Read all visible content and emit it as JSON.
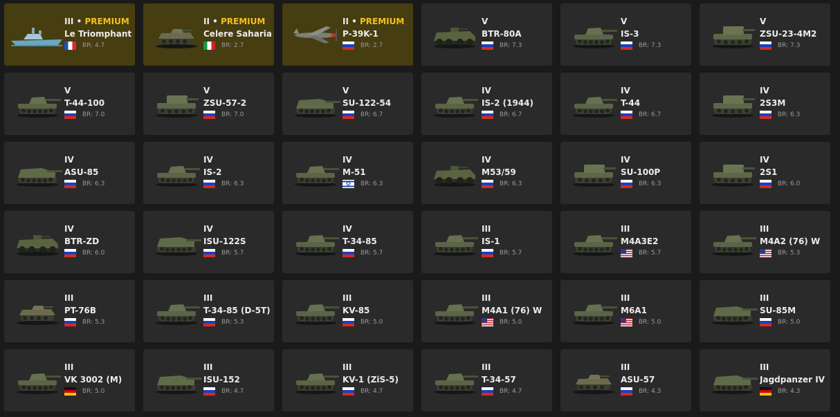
{
  "vehicles": [
    {
      "rank": "III",
      "premium": true,
      "premium_label": "PREMIUM",
      "name": "Le Triomphant",
      "flag": "france",
      "type": "ship",
      "br": "BR: 4.7"
    },
    {
      "rank": "II",
      "premium": true,
      "premium_label": "PREMIUM",
      "name": "Celere Sahariano",
      "flag": "italy",
      "type": "light",
      "br": "BR: 2.7"
    },
    {
      "rank": "II",
      "premium": true,
      "premium_label": "PREMIUM",
      "name": "P-39K-1",
      "flag": "russia",
      "type": "plane",
      "br": "BR: 2.7"
    },
    {
      "rank": "V",
      "name": "BTR-80A",
      "flag": "russia",
      "type": "apc",
      "br": "BR: 7.3"
    },
    {
      "rank": "V",
      "name": "IS-3",
      "flag": "russia",
      "type": "tank",
      "br": "BR: 7.3"
    },
    {
      "rank": "V",
      "name": "ZSU-23-4M2",
      "flag": "russia",
      "type": "spaa",
      "br": "BR: 7.3"
    },
    {
      "rank": "V",
      "name": "T-44-100",
      "flag": "russia",
      "type": "tank",
      "br": "BR: 7.0"
    },
    {
      "rank": "V",
      "name": "ZSU-57-2",
      "flag": "russia",
      "type": "spaa",
      "br": "BR: 7.0"
    },
    {
      "rank": "V",
      "name": "SU-122-54",
      "flag": "russia",
      "type": "td",
      "br": "BR: 6.7"
    },
    {
      "rank": "IV",
      "name": "IS-2 (1944)",
      "flag": "russia",
      "type": "tank",
      "br": "BR: 6.7"
    },
    {
      "rank": "IV",
      "name": "T-44",
      "flag": "russia",
      "type": "tank",
      "br": "BR: 6.7"
    },
    {
      "rank": "IV",
      "name": "2S3M",
      "flag": "russia",
      "type": "spaa",
      "br": "BR: 6.3"
    },
    {
      "rank": "IV",
      "name": "ASU-85",
      "flag": "russia",
      "type": "td",
      "br": "BR: 6.3"
    },
    {
      "rank": "IV",
      "name": "IS-2",
      "flag": "russia",
      "type": "tank",
      "br": "BR: 6.3"
    },
    {
      "rank": "IV",
      "name": "M-51",
      "flag": "israel",
      "type": "tank",
      "br": "BR: 6.3"
    },
    {
      "rank": "IV",
      "name": "M53/59",
      "flag": "russia",
      "type": "apc",
      "br": "BR: 6.3"
    },
    {
      "rank": "IV",
      "name": "SU-100P",
      "flag": "russia",
      "type": "spaa",
      "br": "BR: 6.3"
    },
    {
      "rank": "IV",
      "name": "2S1",
      "flag": "russia",
      "type": "spaa",
      "br": "BR: 6.0"
    },
    {
      "rank": "IV",
      "name": "BTR-ZD",
      "flag": "russia",
      "type": "apc",
      "br": "BR: 6.0"
    },
    {
      "rank": "IV",
      "name": "ISU-122S",
      "flag": "russia",
      "type": "td",
      "br": "BR: 5.7"
    },
    {
      "rank": "IV",
      "name": "T-34-85",
      "flag": "russia",
      "type": "tank",
      "br": "BR: 5.7"
    },
    {
      "rank": "III",
      "name": "IS-1",
      "flag": "russia",
      "type": "tank",
      "br": "BR: 5.7"
    },
    {
      "rank": "III",
      "name": "M4A3E2",
      "flag": "usa",
      "type": "tank",
      "br": "BR: 5.7"
    },
    {
      "rank": "III",
      "name": "M4A2 (76) W",
      "flag": "usa",
      "type": "tank",
      "br": "BR: 5.3"
    },
    {
      "rank": "III",
      "name": "PT-76B",
      "flag": "russia",
      "type": "light",
      "br": "BR: 5.3"
    },
    {
      "rank": "III",
      "name": "T-34-85 (D-5T)",
      "flag": "russia",
      "type": "tank",
      "br": "BR: 5.3"
    },
    {
      "rank": "III",
      "name": "KV-85",
      "flag": "russia",
      "type": "tank",
      "br": "BR: 5.0"
    },
    {
      "rank": "III",
      "name": "M4A1 (76) W",
      "flag": "usa",
      "type": "tank",
      "br": "BR: 5.0"
    },
    {
      "rank": "III",
      "name": "M6A1",
      "flag": "usa",
      "type": "tank",
      "br": "BR: 5.0"
    },
    {
      "rank": "III",
      "name": "SU-85M",
      "flag": "russia",
      "type": "td",
      "br": "BR: 5.0"
    },
    {
      "rank": "III",
      "name": "VK 3002 (M)",
      "flag": "germany",
      "type": "tank",
      "br": "BR: 5.0"
    },
    {
      "rank": "III",
      "name": "ISU-152",
      "flag": "russia",
      "type": "td",
      "br": "BR: 4.7"
    },
    {
      "rank": "III",
      "name": "KV-1 (ZiS-5)",
      "flag": "russia",
      "type": "tank",
      "br": "BR: 4.7"
    },
    {
      "rank": "III",
      "name": "T-34-57",
      "flag": "russia",
      "type": "tank",
      "br": "BR: 4.7"
    },
    {
      "rank": "III",
      "name": "ASU-57",
      "flag": "russia",
      "type": "light",
      "br": "BR: 4.3"
    },
    {
      "rank": "III",
      "name": "Jagdpanzer IV",
      "flag": "germany",
      "type": "td",
      "br": "BR: 4.3"
    }
  ],
  "colors": {
    "page_bg": "#1a1a1a",
    "card_bg": "#2a2a2a",
    "premium_card_bg": "#463d10",
    "premium_text": "#f4c020",
    "text": "#ececec",
    "br_text": "#9a9a9a"
  }
}
